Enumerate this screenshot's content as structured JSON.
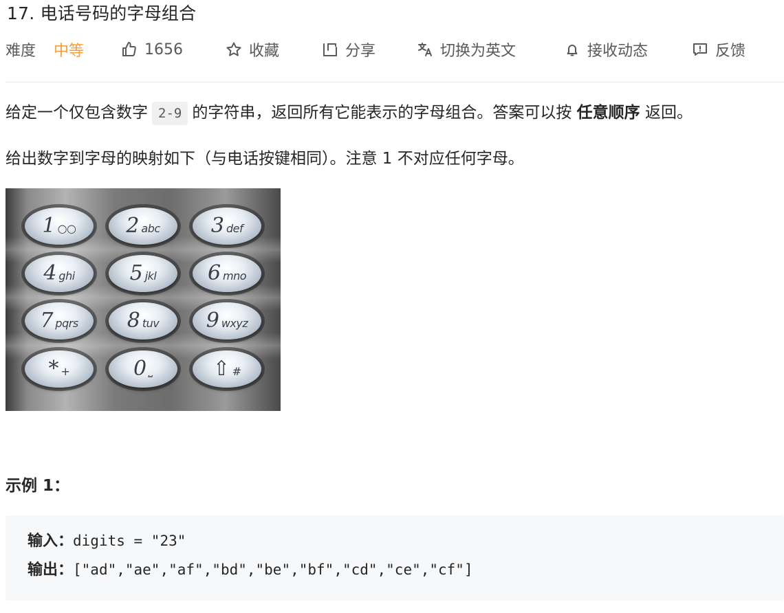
{
  "problem": {
    "title": "17. 电话号码的字母组合"
  },
  "meta": {
    "difficulty_label": "难度",
    "difficulty_value": "中等",
    "likes": "1656",
    "favorite": "收藏",
    "share": "分享",
    "switch_lang": "切换为英文",
    "notify": "接收动态",
    "feedback": "反馈"
  },
  "colors": {
    "difficulty_medium": "#f89e37",
    "text": "#262626",
    "muted": "#595959",
    "code_bg": "#f7f8fa"
  },
  "icons": [
    "thumbs-up-icon",
    "star-icon",
    "share-icon",
    "translate-icon",
    "bell-icon",
    "feedback-icon"
  ],
  "description": {
    "p1_before": "给定一个仅包含数字",
    "p1_code": "2-9",
    "p1_middle": "的字符串，返回所有它能表示的字母组合。答案可以按",
    "p1_bold": "任意顺序",
    "p1_after": "返回。",
    "p2": "给出数字到字母的映射如下（与电话按键相同）。注意 1 不对应任何字母。"
  },
  "keypad": {
    "keys": [
      {
        "digit": "1",
        "letters": "○○"
      },
      {
        "digit": "2",
        "letters": "abc"
      },
      {
        "digit": "3",
        "letters": "def"
      },
      {
        "digit": "4",
        "letters": "ghi"
      },
      {
        "digit": "5",
        "letters": "jkl"
      },
      {
        "digit": "6",
        "letters": "mno"
      },
      {
        "digit": "7",
        "letters": "pqrs"
      },
      {
        "digit": "8",
        "letters": "tuv"
      },
      {
        "digit": "9",
        "letters": "wxyz"
      },
      {
        "digit": "*",
        "letters": "+"
      },
      {
        "digit": "0",
        "letters": "⎵"
      },
      {
        "digit": "⇧",
        "letters": "#"
      }
    ]
  },
  "example": {
    "title": "示例 1：",
    "input_label": "输入：",
    "input_value": "digits = \"23\"",
    "output_label": "输出：",
    "output_value": "[\"ad\",\"ae\",\"af\",\"bd\",\"be\",\"bf\",\"cd\",\"ce\",\"cf\"]"
  }
}
